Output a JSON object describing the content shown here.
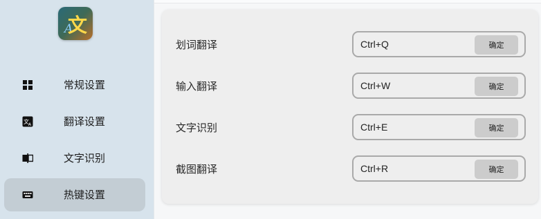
{
  "app": {
    "logo_char": "文",
    "logo_latin": "A"
  },
  "sidebar": {
    "items": [
      {
        "label": "常规设置",
        "icon": "grid-icon",
        "active": false
      },
      {
        "label": "翻译设置",
        "icon": "translate-icon",
        "active": false
      },
      {
        "label": "文字识别",
        "icon": "ocr-icon",
        "active": false
      },
      {
        "label": "热键设置",
        "icon": "keyboard-icon",
        "active": true
      }
    ]
  },
  "hotkeys": {
    "rows": [
      {
        "label": "划词翻译",
        "value": "Ctrl+Q",
        "button": "确定"
      },
      {
        "label": "输入翻译",
        "value": "Ctrl+W",
        "button": "确定"
      },
      {
        "label": "文字识别",
        "value": "Ctrl+E",
        "button": "确定"
      },
      {
        "label": "截图翻译",
        "value": "Ctrl+R",
        "button": "确定"
      }
    ]
  },
  "colors": {
    "sidebar_bg": "#d7e3ec",
    "active_item_bg": "#c3cdd4",
    "panel_bg": "#eeeeee",
    "button_bg": "#cccccc"
  }
}
